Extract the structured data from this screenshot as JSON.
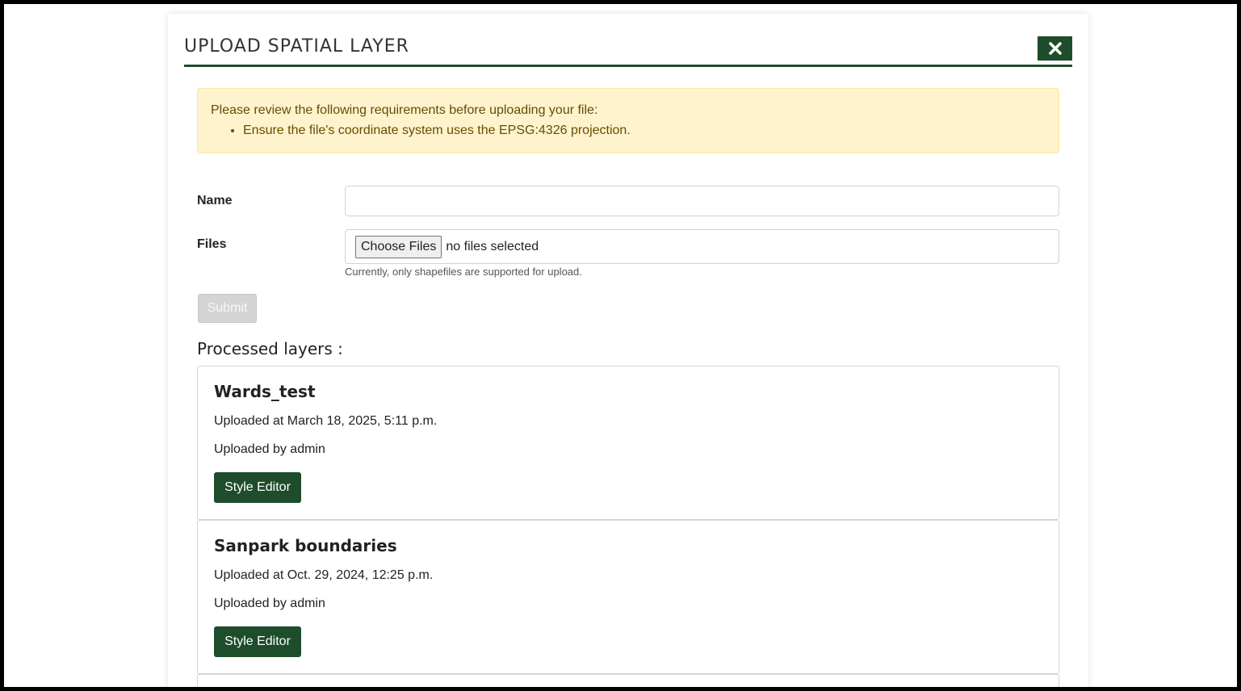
{
  "modal": {
    "title": "UPLOAD SPATIAL LAYER",
    "close_icon": "close-icon"
  },
  "alert": {
    "intro": "Please review the following requirements before uploading your file:",
    "items": [
      "Ensure the file's coordinate system uses the EPSG:4326 projection."
    ]
  },
  "form": {
    "name_label": "Name",
    "name_value": "",
    "files_label": "Files",
    "choose_files_label": "Choose Files",
    "file_status": "no files selected",
    "files_help": "Currently, only shapefiles are supported for upload.",
    "submit_label": "Submit"
  },
  "processed": {
    "title": "Processed layers :",
    "layers": [
      {
        "name": "Wards_test",
        "uploaded_at": "Uploaded at March 18, 2025, 5:11 p.m.",
        "uploaded_by": "Uploaded by admin",
        "button": "Style Editor"
      },
      {
        "name": "Sanpark boundaries",
        "uploaded_at": "Uploaded at Oct. 29, 2024, 12:25 p.m.",
        "uploaded_by": "Uploaded by admin",
        "button": "Style Editor"
      }
    ]
  },
  "colors": {
    "brand": "#1e4d2b",
    "alert_bg": "#fff3cd",
    "alert_text": "#664d03",
    "disabled": "#d4d4d4"
  }
}
